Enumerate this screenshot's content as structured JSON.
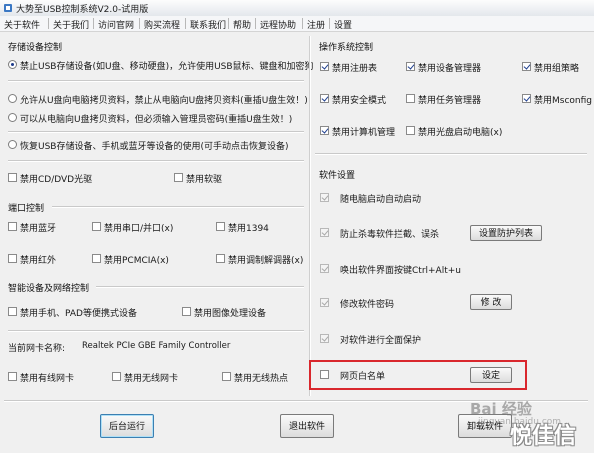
{
  "window": {
    "title": "大势至USB控制系统V2.0-试用版"
  },
  "menu": [
    "关于软件",
    "关于我们",
    "访问官网",
    "购买流程",
    "联系我们",
    "帮助",
    "远程协助",
    "注册",
    "设置"
  ],
  "storage": {
    "title": "存储设备控制",
    "options": [
      {
        "label": "禁止USB存储设备(如U盘、移动硬盘)，允许使用USB鼠标、键盘和加密狗",
        "selected": true
      },
      {
        "label": "允许从U盘向电脑拷贝资料，禁止从电脑向U盘拷贝资料(重插U盘生效！)",
        "selected": false
      },
      {
        "label": "可以从电脑向U盘拷贝资料，但必须输入管理员密码(重插U盘生效！)",
        "selected": false
      },
      {
        "label": "恢复USB存储设备、手机或蓝牙等设备的使用(可手动点击恢复设备)",
        "selected": false
      }
    ],
    "checks": [
      {
        "label": "禁用CD/DVD光驱",
        "checked": false
      },
      {
        "label": "禁用软驱",
        "checked": false
      }
    ]
  },
  "ports": {
    "title": "端口控制",
    "checks": [
      {
        "label": "禁用蓝牙",
        "checked": false
      },
      {
        "label": "禁用串口/并口(x)",
        "checked": false
      },
      {
        "label": "禁用1394",
        "checked": false
      },
      {
        "label": "禁用红外",
        "checked": false
      },
      {
        "label": "禁用PCMCIA(x)",
        "checked": false
      },
      {
        "label": "禁用调制解调器(x)",
        "checked": false
      }
    ]
  },
  "smart": {
    "title": "智能设备及网络控制",
    "checks": [
      {
        "label": "禁用手机、PAD等便携式设备",
        "checked": false
      },
      {
        "label": "禁用图像处理设备",
        "checked": false
      }
    ],
    "nic_label": "当前网卡名称:",
    "nic_value": "Realtek PCIe GBE Family Controller",
    "net_checks": [
      {
        "label": "禁用有线网卡",
        "checked": false
      },
      {
        "label": "禁用无线网卡",
        "checked": false
      },
      {
        "label": "禁用无线热点",
        "checked": false
      }
    ]
  },
  "os": {
    "title": "操作系统控制",
    "checks": [
      {
        "label": "禁用注册表",
        "checked": true
      },
      {
        "label": "禁用设备管理器",
        "checked": true
      },
      {
        "label": "禁用组策略",
        "checked": true
      },
      {
        "label": "禁用安全模式",
        "checked": true
      },
      {
        "label": "禁用任务管理器",
        "checked": false
      },
      {
        "label": "禁用Msconfig",
        "checked": true
      },
      {
        "label": "禁用计算机管理",
        "checked": true
      },
      {
        "label": "禁用光盘启动电脑(x)",
        "checked": false
      }
    ]
  },
  "settings": {
    "title": "软件设置",
    "items": [
      {
        "label": "随电脑启动自动启动",
        "checked": true,
        "disabled": true
      },
      {
        "label": "防止杀毒软件拦截、误杀",
        "checked": true,
        "disabled": true
      },
      {
        "label": "唤出软件界面按键Ctrl+Alt+u",
        "checked": true,
        "disabled": true
      },
      {
        "label": "修改软件密码",
        "checked": true,
        "disabled": true
      },
      {
        "label": "对软件进行全面保护",
        "checked": true,
        "disabled": true
      },
      {
        "label": "网页白名单",
        "checked": false,
        "disabled": false
      }
    ],
    "protect_list_button": "设置防护列表",
    "modify_button": "修 改",
    "whitelist_button": "设定"
  },
  "footer": {
    "background_button": "后台运行",
    "exit_button": "退出软件",
    "uninstall_button": "卸载软件"
  },
  "watermark": {
    "baidu": "Bai 经验",
    "url": "jingyan.baidu.com",
    "brand": "悦佳信"
  }
}
